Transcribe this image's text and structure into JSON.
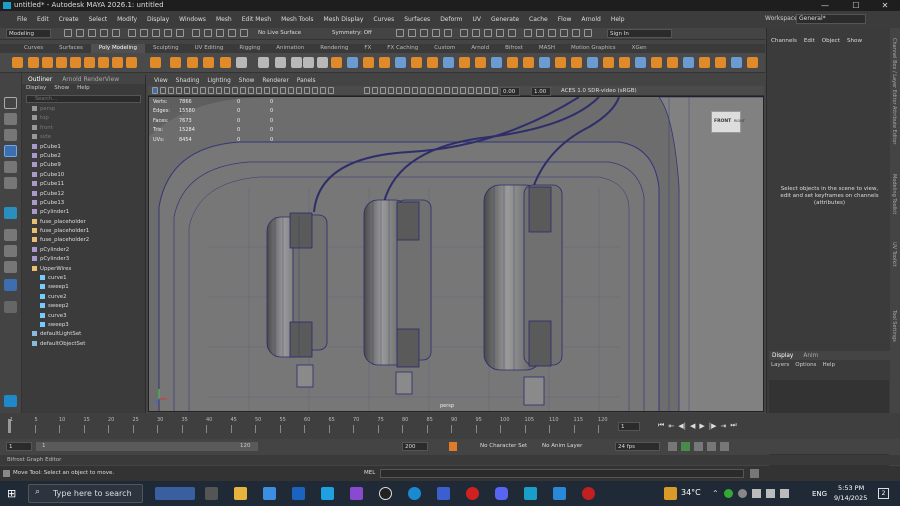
{
  "window": {
    "title": "untitled* - Autodesk MAYA 2026.1: untitled",
    "minimize": "—",
    "maximize": "☐",
    "close": "✕"
  },
  "menubar": {
    "items": [
      "File",
      "Edit",
      "Create",
      "Select",
      "Modify",
      "Display",
      "Windows",
      "Mesh",
      "Edit Mesh",
      "Mesh Tools",
      "Mesh Display",
      "Curves",
      "Surfaces",
      "Deform",
      "UV",
      "Generate",
      "Cache",
      "Flow",
      "Arnold",
      "Help"
    ],
    "workspace_label": "Workspace:",
    "workspace_value": "General*"
  },
  "statusline": {
    "mode": "Modeling",
    "live_surface": "No Live Surface",
    "symmetry": "Symmetry: Off",
    "sign_in": "Sign In"
  },
  "shelf_tabs": [
    "Curves",
    "Surfaces",
    "Poly Modeling",
    "Sculpting",
    "UV Editing",
    "Rigging",
    "Animation",
    "Rendering",
    "FX",
    "FX Caching",
    "Custom",
    "Arnold",
    "Bifrost",
    "MASH",
    "Motion Graphics",
    "XGen"
  ],
  "shelf_active": "Poly Modeling",
  "outliner": {
    "tabs": [
      "Outliner",
      "Arnold RenderView"
    ],
    "menus": [
      "Display",
      "Show",
      "Help"
    ],
    "search_placeholder": "Search...",
    "items": [
      {
        "name": "persp",
        "dim": true,
        "indent": 0,
        "type": "cam"
      },
      {
        "name": "top",
        "dim": true,
        "indent": 0,
        "type": "cam"
      },
      {
        "name": "front",
        "dim": true,
        "indent": 0,
        "type": "cam"
      },
      {
        "name": "side",
        "dim": true,
        "indent": 0,
        "type": "cam"
      },
      {
        "name": "pCube1",
        "indent": 0,
        "type": "mesh"
      },
      {
        "name": "pCube2",
        "indent": 0,
        "type": "mesh"
      },
      {
        "name": "pCube9",
        "indent": 0,
        "type": "mesh"
      },
      {
        "name": "pCube10",
        "indent": 0,
        "type": "mesh"
      },
      {
        "name": "pCube11",
        "indent": 0,
        "type": "mesh"
      },
      {
        "name": "pCube12",
        "indent": 0,
        "type": "mesh"
      },
      {
        "name": "pCube13",
        "indent": 0,
        "type": "mesh"
      },
      {
        "name": "pCylinder1",
        "indent": 0,
        "type": "mesh"
      },
      {
        "name": "fuse_placeholder",
        "indent": 0,
        "type": "group"
      },
      {
        "name": "fuse_placeholder1",
        "indent": 0,
        "type": "group"
      },
      {
        "name": "fuse_placeholder2",
        "indent": 0,
        "type": "group"
      },
      {
        "name": "pCylinder2",
        "indent": 0,
        "type": "mesh"
      },
      {
        "name": "pCylinder3",
        "indent": 0,
        "type": "mesh"
      },
      {
        "name": "UpperWires",
        "indent": 0,
        "type": "group"
      },
      {
        "name": "curve1",
        "indent": 1,
        "type": "curve"
      },
      {
        "name": "sweep1",
        "indent": 1,
        "type": "sweep"
      },
      {
        "name": "curve2",
        "indent": 1,
        "type": "curve"
      },
      {
        "name": "sweep2",
        "indent": 1,
        "type": "sweep"
      },
      {
        "name": "curve3",
        "indent": 1,
        "type": "curve"
      },
      {
        "name": "sweep3",
        "indent": 1,
        "type": "sweep"
      },
      {
        "name": "defaultLightSet",
        "indent": 0,
        "type": "set"
      },
      {
        "name": "defaultObjectSet",
        "indent": 0,
        "type": "set"
      }
    ]
  },
  "viewport": {
    "menus": [
      "View",
      "Shading",
      "Lighting",
      "Show",
      "Renderer",
      "Panels"
    ],
    "field1": "0.00",
    "field2": "1.00",
    "color_space": "ACES 1.0 SDR-video (sRGB)",
    "camera_label": "persp",
    "viewcube_front": "FRONT",
    "viewcube_right": "RIGHT",
    "hud": [
      {
        "label": "Verts:",
        "v1": "7866",
        "v2": "0",
        "v3": "0"
      },
      {
        "label": "Edges:",
        "v1": "15580",
        "v2": "0",
        "v3": "0"
      },
      {
        "label": "Faces:",
        "v1": "7673",
        "v2": "0",
        "v3": "0"
      },
      {
        "label": "Tris:",
        "v1": "15284",
        "v2": "0",
        "v3": "0"
      },
      {
        "label": "UVs:",
        "v1": "8454",
        "v2": "0",
        "v3": "0"
      }
    ]
  },
  "channel_box": {
    "tabs": [
      "Channels",
      "Edit",
      "Object",
      "Show"
    ],
    "message": "Select objects in the scene to view, edit and set keyframes on channels (attributes)",
    "layer_tabs": [
      "Display",
      "Anim"
    ],
    "layer_menus": [
      "Layers",
      "Options",
      "Help"
    ]
  },
  "side_tabs": [
    "Channel Box / Layer Editor",
    "Attribute Editor",
    "Modeling Toolkit",
    "UV Toolkit",
    "Tool Settings"
  ],
  "timeline": {
    "ticks": [
      "1",
      "5",
      "10",
      "15",
      "20",
      "25",
      "30",
      "35",
      "40",
      "45",
      "50",
      "55",
      "60",
      "65",
      "70",
      "75",
      "80",
      "85",
      "90",
      "95",
      "100",
      "105",
      "110",
      "115",
      "120"
    ],
    "current_frame": "1",
    "range_start": "1",
    "range_inner_start": "1",
    "range_inner_end": "120",
    "range_end": "200",
    "character_set": "No Character Set",
    "anim_layer": "No Anim Layer",
    "fps": "24 fps"
  },
  "bifrost_label": "Bifrost Graph Editor",
  "helpline": {
    "message": "Move Tool: Select an object to move.",
    "mel_label": "MEL"
  },
  "taskbar": {
    "search_placeholder": "Type here to search",
    "temperature": "34°C",
    "language": "ENG",
    "time": "5:53 PM",
    "date": "9/14/2025",
    "notifications": "2"
  }
}
